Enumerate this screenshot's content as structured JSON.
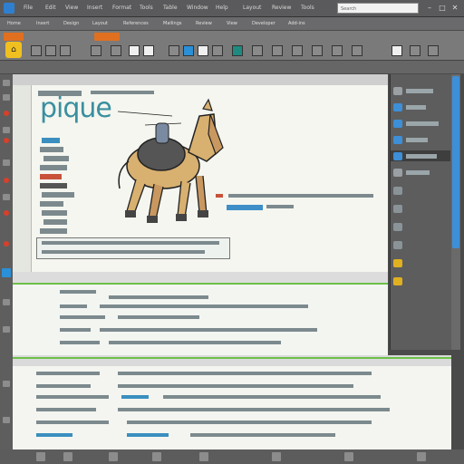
{
  "titlebar": {
    "menu": [
      "File",
      "Edit",
      "View",
      "Insert",
      "Format",
      "Tools",
      "Table",
      "Window",
      "Help",
      "Layout",
      "Review",
      "Tools",
      "Add-ins",
      "Help"
    ],
    "search_placeholder": "Search",
    "window_controls": [
      "–",
      "□",
      "✕"
    ]
  },
  "toolbar": {
    "tabs": [
      "Home",
      "Insert",
      "Design",
      "Layout",
      "References",
      "Mailings",
      "Review",
      "View",
      "Developer",
      "Add-ins"
    ]
  },
  "document": {
    "logo_text": "pique",
    "icons": {
      "home": "home-icon",
      "horse": "horse-illustration"
    }
  },
  "colors": {
    "accent": "#3d8fd8",
    "logo": "#3a8fa0",
    "orange": "#e07020",
    "yellow": "#f0c020",
    "marker_red": "#d8402a",
    "status_green": "#6cc04a"
  }
}
